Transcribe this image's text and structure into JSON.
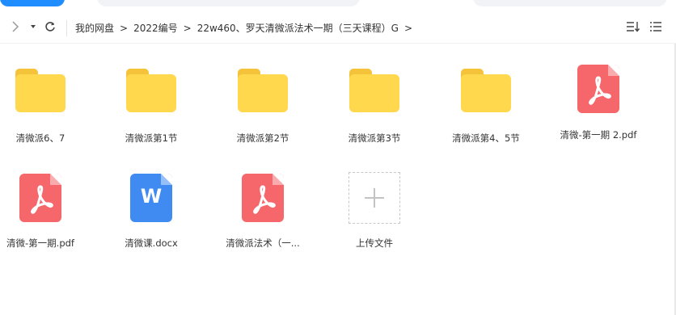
{
  "breadcrumb": {
    "items": [
      "我的网盘",
      "2022编号",
      "22w460、罗天清微派法术一期（三天课程）G"
    ],
    "separator": ">"
  },
  "icons": {
    "forward": "chevron-right-icon",
    "dropdown": "caret-down-icon",
    "refresh": "refresh-icon",
    "sort": "sort-icon",
    "view": "list-view-icon"
  },
  "files": [
    {
      "name": "清微派6、7",
      "type": "folder"
    },
    {
      "name": "清微派第1节",
      "type": "folder"
    },
    {
      "name": "清微派第2节",
      "type": "folder"
    },
    {
      "name": "清微派第3节",
      "type": "folder"
    },
    {
      "name": "清微派第4、5节",
      "type": "folder"
    },
    {
      "name": "清微-第一期 2.pdf",
      "type": "pdf"
    },
    {
      "name": "清微-第一期.pdf",
      "type": "pdf"
    },
    {
      "name": "清微课.docx",
      "type": "docx",
      "glyph": "W"
    },
    {
      "name": "清微派法术（一...",
      "type": "pdf"
    }
  ],
  "upload": {
    "label": "上传文件"
  },
  "colors": {
    "folder": "#ffd84d",
    "pdf": "#f5676b",
    "word": "#3f8bf2",
    "accent": "#1f8cff"
  }
}
